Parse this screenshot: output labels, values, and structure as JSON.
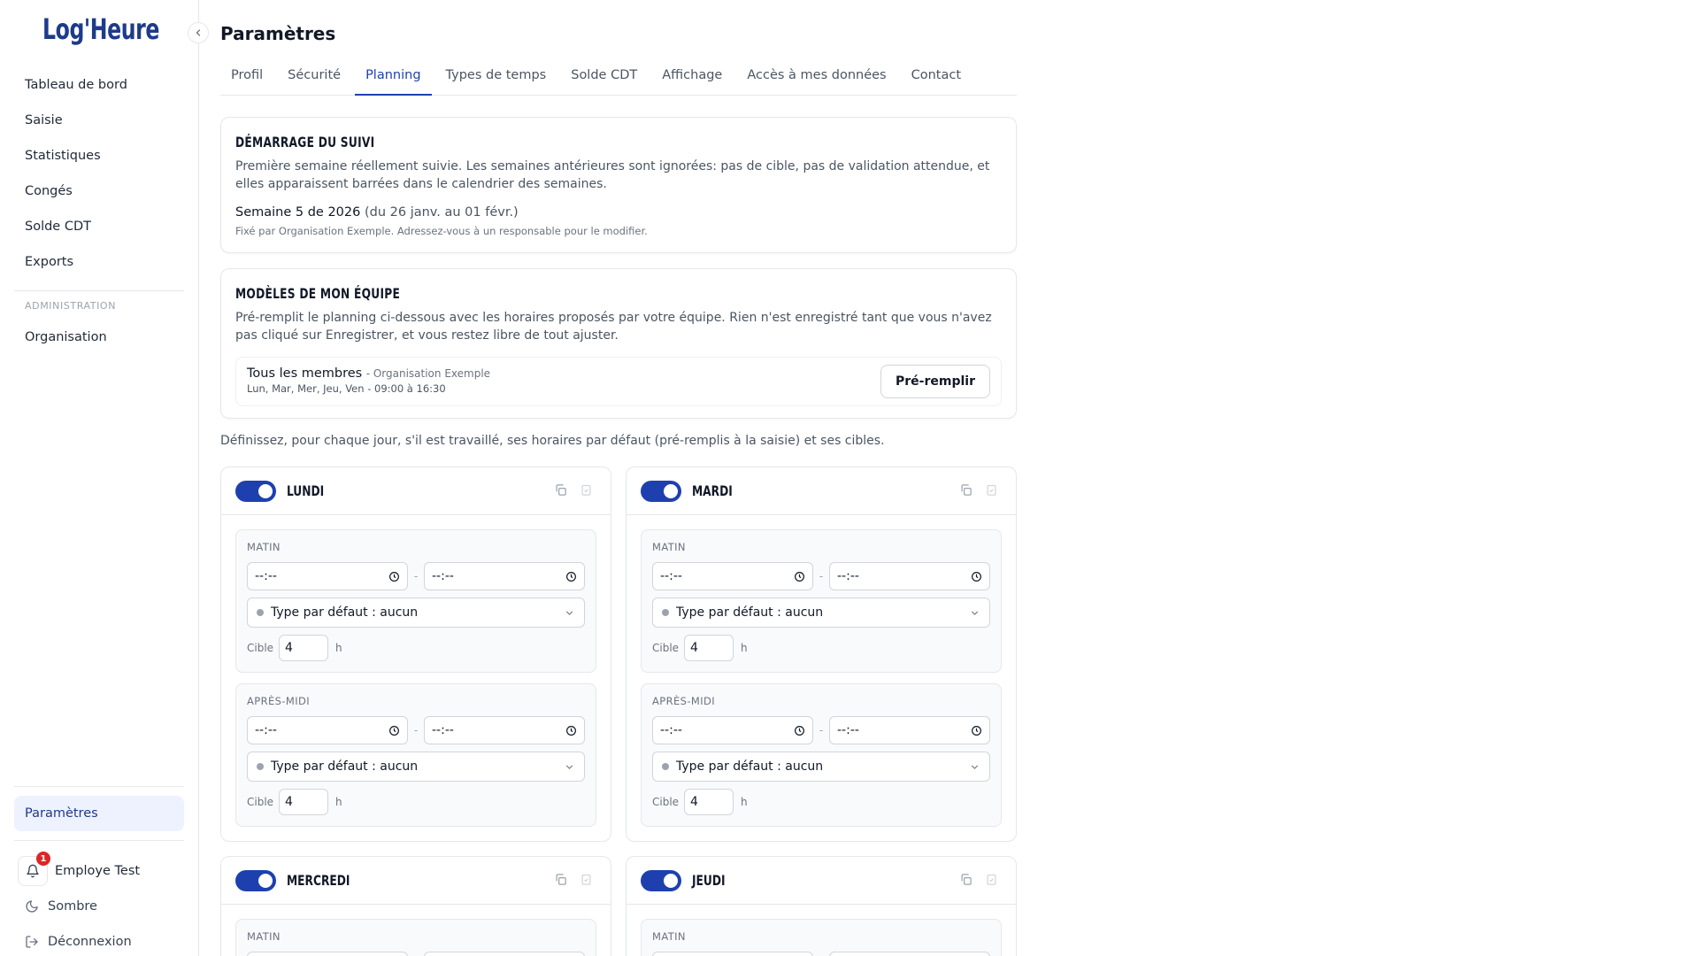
{
  "app": {
    "logo": "Log'Heure"
  },
  "sidebar": {
    "items": [
      {
        "label": "Tableau de bord"
      },
      {
        "label": "Saisie"
      },
      {
        "label": "Statistiques"
      },
      {
        "label": "Congés"
      },
      {
        "label": "Solde CDT"
      },
      {
        "label": "Exports"
      }
    ],
    "admin_section": "ADMINISTRATION",
    "admin_items": [
      {
        "label": "Organisation"
      }
    ],
    "settings_label": "Paramètres",
    "user_name": "Employe Test",
    "notification_count": "1",
    "theme_label": "Sombre",
    "logout_label": "Déconnexion"
  },
  "page": {
    "title": "Paramètres"
  },
  "tabs": [
    {
      "label": "Profil"
    },
    {
      "label": "Sécurité"
    },
    {
      "label": "Planning"
    },
    {
      "label": "Types de temps"
    },
    {
      "label": "Solde CDT"
    },
    {
      "label": "Affichage"
    },
    {
      "label": "Accès à mes données"
    },
    {
      "label": "Contact"
    }
  ],
  "active_tab": "Planning",
  "tracking": {
    "title": "DÉMARRAGE DU SUIVI",
    "description": "Première semaine réellement suivie. Les semaines antérieures sont ignorées: pas de cible, pas de validation attendue, et elles apparaissent barrées dans le calendrier des semaines.",
    "week": "Semaine 5 de 2026",
    "week_range": "(du 26 janv. au 01 févr.)",
    "note": "Fixé par Organisation Exemple. Adressez-vous à un responsable pour le modifier."
  },
  "team_models": {
    "title": "MODÈLES DE MON ÉQUIPE",
    "description": "Pré-remplit le planning ci-dessous avec les horaires proposés par votre équipe. Rien n'est enregistré tant que vous n'avez pas cliqué sur Enregistrer, et vous restez libre de tout ajuster.",
    "model_name": "Tous les membres",
    "model_org": "- Organisation Exemple",
    "model_schedule": "Lun, Mar, Mer, Jeu, Ven - 09:00 à 16:30",
    "prefill_label": "Pré-remplir"
  },
  "define_text": "Définissez, pour chaque jour, s'il est travaillé, ses horaires par défaut (pré-remplis à la saisie) et ses cibles.",
  "days": [
    {
      "name": "LUNDI",
      "enabled": true,
      "morning": {
        "label": "MATIN",
        "start": "--:--",
        "end": "--:--",
        "type": "Type par défaut : aucun",
        "target_label": "Cible",
        "target": "4",
        "unit": "h"
      },
      "afternoon": {
        "label": "APRÈS-MIDI",
        "start": "--:--",
        "end": "--:--",
        "type": "Type par défaut : aucun",
        "target_label": "Cible",
        "target": "4",
        "unit": "h"
      }
    },
    {
      "name": "MARDI",
      "enabled": true,
      "morning": {
        "label": "MATIN",
        "start": "--:--",
        "end": "--:--",
        "type": "Type par défaut : aucun",
        "target_label": "Cible",
        "target": "4",
        "unit": "h"
      },
      "afternoon": {
        "label": "APRÈS-MIDI",
        "start": "--:--",
        "end": "--:--",
        "type": "Type par défaut : aucun",
        "target_label": "Cible",
        "target": "4",
        "unit": "h"
      }
    },
    {
      "name": "MERCREDI",
      "enabled": true,
      "morning": {
        "label": "MATIN"
      }
    },
    {
      "name": "JEUDI",
      "enabled": true,
      "morning": {
        "label": "MATIN"
      }
    }
  ],
  "colors": {
    "accent": "#1e40af",
    "logo": "#1e3a8a",
    "badge": "#dc2626"
  }
}
